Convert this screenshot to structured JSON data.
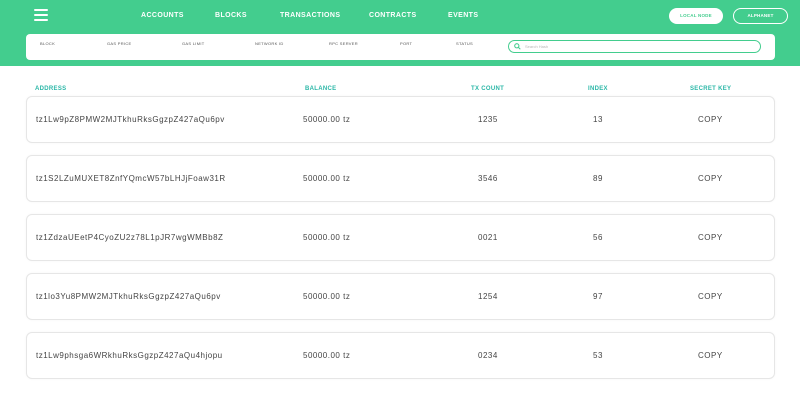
{
  "nav": {
    "items": [
      "ACCOUNTS",
      "BLOCKS",
      "TRANSACTIONS",
      "CONTRACTS",
      "EVENTS"
    ],
    "local_node_label": "LOCAL NODE",
    "alphanet_label": "ALPHANET"
  },
  "info": {
    "labels": [
      "BLOCK",
      "GAS PRICE",
      "GAS LIMIT",
      "NETWORK ID",
      "RPC SERVER",
      "PORT",
      "STATUS"
    ],
    "search_placeholder": "Search Hash"
  },
  "table": {
    "headers": [
      "ADDRESS",
      "BALANCE",
      "TX COUNT",
      "INDEX",
      "SECRET KEY"
    ],
    "rows": [
      {
        "address": "tz1Lw9pZ8PMW2MJTkhuRksGgzpZ427aQu6pv",
        "balance": "50000.00 tz",
        "tx_count": "1235",
        "index": "13",
        "secret": "COPY"
      },
      {
        "address": "tz1S2LZuMUXET8ZnfYQmcW57bLHJjFoaw31R",
        "balance": "50000.00 tz",
        "tx_count": "3546",
        "index": "89",
        "secret": "COPY"
      },
      {
        "address": "tz1ZdzaUEetP4CyoZU2z78L1pJR7wgWMBb8Z",
        "balance": "50000.00 tz",
        "tx_count": "0021",
        "index": "56",
        "secret": "COPY"
      },
      {
        "address": "tz1lo3Yu8PMW2MJTkhuRksGgzpZ427aQu6pv",
        "balance": "50000.00 tz",
        "tx_count": "1254",
        "index": "97",
        "secret": "COPY"
      },
      {
        "address": "tz1Lw9phsga6WRkhuRksGgzpZ427aQu4hjopu",
        "balance": "50000.00 tz",
        "tx_count": "0234",
        "index": "53",
        "secret": "COPY"
      }
    ]
  },
  "colors": {
    "brand": "#43cd8e",
    "header_text": "#2bb7a7"
  }
}
